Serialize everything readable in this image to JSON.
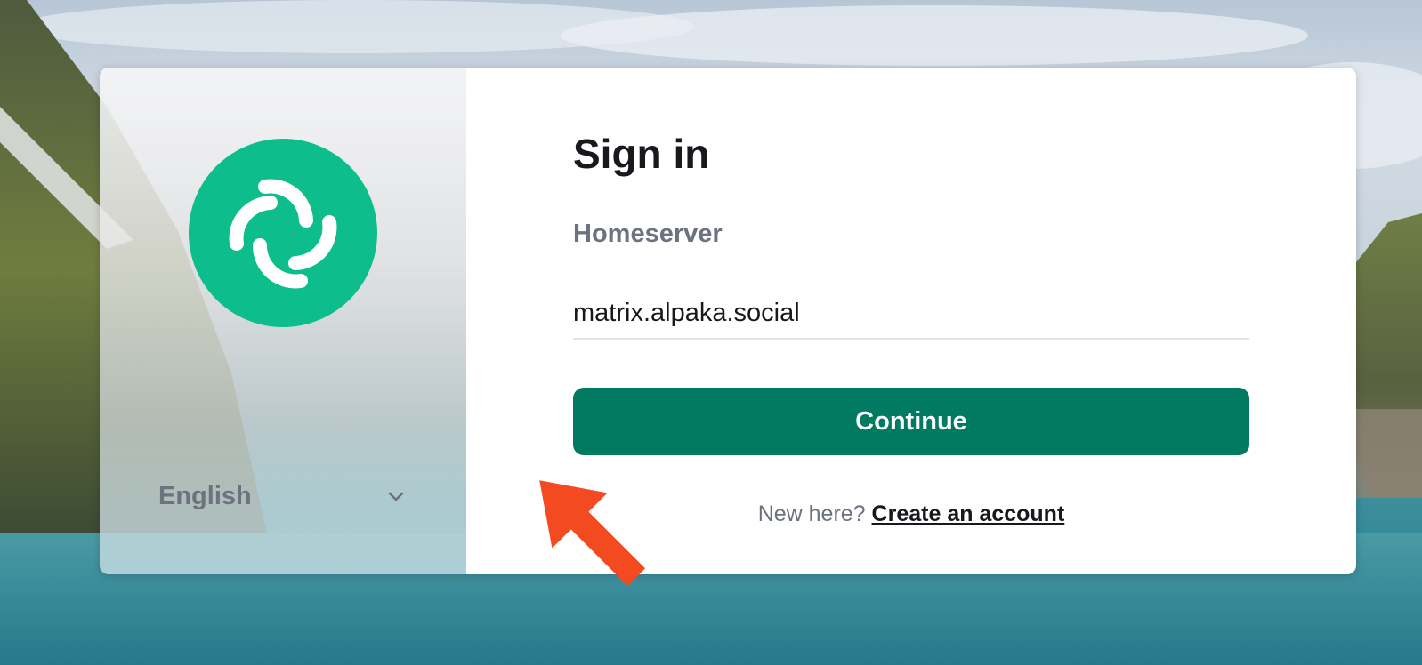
{
  "colors": {
    "brand_green": "#0dbd8b",
    "button_green": "#007a61",
    "heading": "#17191c",
    "secondary_text": "#6c737e",
    "annotation_arrow": "#f44a22"
  },
  "branding": {
    "logo_icon": "element-logo-icon"
  },
  "language_picker": {
    "selected": "English",
    "icon": "chevron-down-icon"
  },
  "signin": {
    "title": "Sign in",
    "homeserver_label": "Homeserver",
    "homeserver_value": "matrix.alpaka.social",
    "continue_label": "Continue",
    "new_here_text": "New here?",
    "create_account_label": "Create an account"
  },
  "annotation": {
    "icon": "pointer-arrow-icon"
  }
}
